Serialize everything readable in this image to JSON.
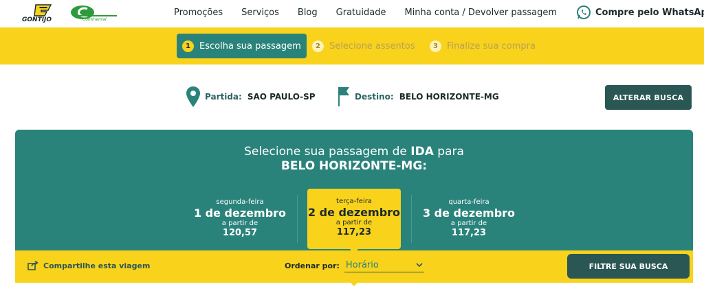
{
  "header": {
    "brand_primary": "GONTIJO",
    "brand_secondary": "Continental",
    "nav": [
      "Promoções",
      "Serviços",
      "Blog",
      "Gratuidade",
      "Minha conta / Devolver passagem"
    ],
    "whatsapp_label": "Compre pelo WhatsApp",
    "whatsapp_icon": "whatsapp-icon"
  },
  "steps": [
    {
      "number": "1",
      "label": "Escolha sua passagem",
      "active": true
    },
    {
      "number": "2",
      "label": "Selecione assentos",
      "active": false
    },
    {
      "number": "3",
      "label": "Finalize sua compra",
      "active": false
    }
  ],
  "route": {
    "origin_label": "Partida:",
    "origin_value": "SAO PAULO-SP",
    "origin_icon": "map-pin-icon",
    "destination_label": "Destino:",
    "destination_value": "BELO HORIZONTE-MG",
    "destination_icon": "flag-icon",
    "change_button": "ALTERAR BUSCA"
  },
  "panel": {
    "title_prefix": "Selecione sua passagem de ",
    "title_bold": "IDA",
    "title_suffix": " para",
    "destination": "BELO HORIZONTE-MG:"
  },
  "days": [
    {
      "weekday": "segunda-feira",
      "date": "1 de dezembro",
      "from": "a partir de",
      "price": "120,57",
      "selected": false
    },
    {
      "weekday": "terça-feira",
      "date": "2 de dezembro",
      "from": "a partir de",
      "price": "117,23",
      "selected": true
    },
    {
      "weekday": "quarta-feira",
      "date": "3 de dezembro",
      "from": "a partir de",
      "price": "117,23",
      "selected": false
    }
  ],
  "toolbar": {
    "share_label": "Compartilhe esta viagem",
    "share_icon": "share-icon",
    "order_label": "Ordenar por:",
    "order_value": "Horário",
    "filter_button": "FILTRE SUA BUSCA"
  },
  "colors": {
    "teal": "#2a837b",
    "dark_teal": "#2a5754",
    "yellow": "#f9d21b"
  }
}
